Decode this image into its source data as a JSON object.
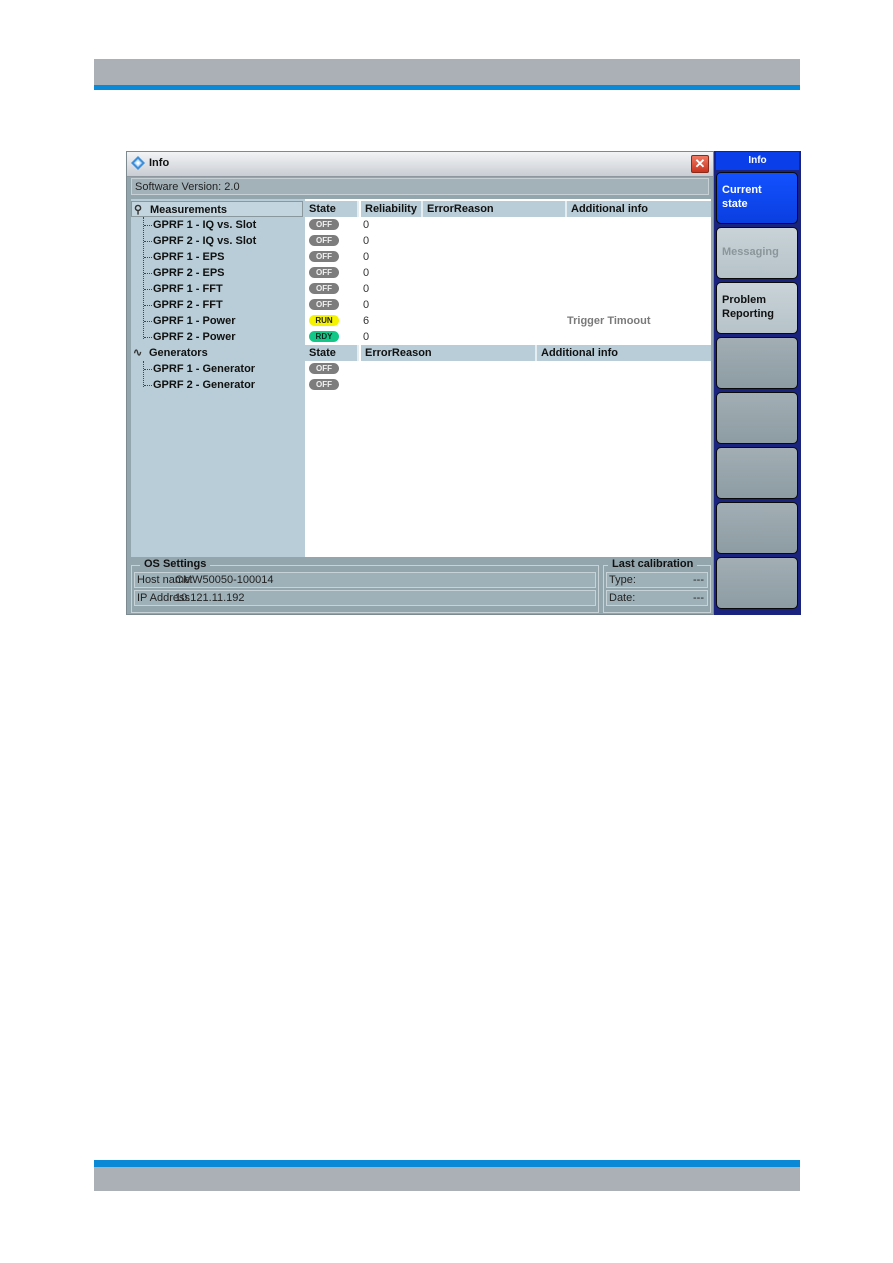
{
  "window": {
    "title": "Info",
    "close_label": "✕",
    "software_version_label": "Software Version:",
    "software_version": "2.0"
  },
  "tree": {
    "measurements": {
      "label": "Measurements",
      "items": [
        "GPRF 1 - IQ vs. Slot",
        "GPRF 2 - IQ vs. Slot",
        "GPRF 1 - EPS",
        "GPRF 2 - EPS",
        "GPRF 1 - FFT",
        "GPRF 2 - FFT",
        "GPRF 1 - Power",
        "GPRF 2 - Power"
      ]
    },
    "generators": {
      "label": "Generators",
      "items": [
        "GPRF 1 - Generator",
        "GPRF 2 - Generator"
      ]
    }
  },
  "measurements_table": {
    "headers": [
      "State",
      "Reliability",
      "ErrorReason",
      "Additional info"
    ],
    "rows": [
      {
        "state": "OFF",
        "reliability": "0",
        "error_reason": "",
        "additional_info": ""
      },
      {
        "state": "OFF",
        "reliability": "0",
        "error_reason": "",
        "additional_info": ""
      },
      {
        "state": "OFF",
        "reliability": "0",
        "error_reason": "",
        "additional_info": ""
      },
      {
        "state": "OFF",
        "reliability": "0",
        "error_reason": "",
        "additional_info": ""
      },
      {
        "state": "OFF",
        "reliability": "0",
        "error_reason": "",
        "additional_info": ""
      },
      {
        "state": "OFF",
        "reliability": "0",
        "error_reason": "",
        "additional_info": ""
      },
      {
        "state": "RUN",
        "reliability": "6",
        "error_reason": "",
        "additional_info": "Trigger Timoout"
      },
      {
        "state": "RDY",
        "reliability": "0",
        "error_reason": "",
        "additional_info": ""
      }
    ]
  },
  "generators_table": {
    "headers": [
      "State",
      "ErrorReason",
      "Additional info"
    ],
    "rows": [
      {
        "state": "OFF",
        "error_reason": "",
        "additional_info": ""
      },
      {
        "state": "OFF",
        "error_reason": "",
        "additional_info": ""
      }
    ]
  },
  "state_colors": {
    "OFF": "#7d7d7d",
    "RUN": "#f6f300",
    "RDY": "#13c788"
  },
  "os_settings": {
    "legend": "OS Settings",
    "host_name_label": "Host name:",
    "host_name": "CMW50050-100014",
    "ip_address_label": "IP Address",
    "ip_address": "10.121.11.192"
  },
  "last_calibration": {
    "legend": "Last calibration",
    "type_label": "Type:",
    "type_value": "---",
    "date_label": "Date:",
    "date_value": "---"
  },
  "softkeys": {
    "title": "Info",
    "keys": [
      {
        "line1": "Current",
        "line2": "state",
        "state": "active"
      },
      {
        "line1": "Messaging",
        "line2": "",
        "state": "disabled"
      },
      {
        "line1": "Problem",
        "line2": "Reporting",
        "state": "enabled"
      },
      {
        "line1": "",
        "line2": "",
        "state": "empty"
      },
      {
        "line1": "",
        "line2": "",
        "state": "empty"
      },
      {
        "line1": "",
        "line2": "",
        "state": "empty"
      },
      {
        "line1": "",
        "line2": "",
        "state": "empty"
      },
      {
        "line1": "",
        "line2": "",
        "state": "empty"
      }
    ]
  },
  "colors": {
    "accent_blue": "#0a8ad6",
    "softkey_active": "#0a3ee8",
    "panel_bg": "#b8cdd7"
  }
}
